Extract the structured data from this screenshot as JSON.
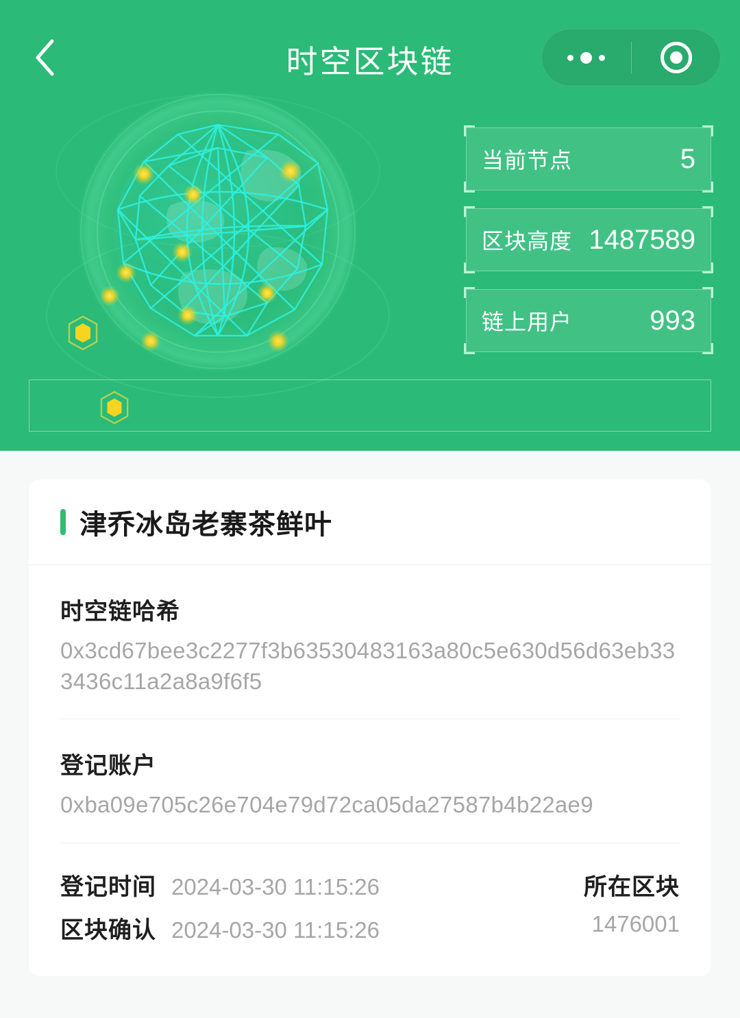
{
  "nav": {
    "back_icon": "chevron-left-icon",
    "title": "时空区块链",
    "capsule": {
      "more_icon": "more-dots-icon",
      "target_icon": "target-circle-icon"
    }
  },
  "hero": {
    "globe_icon": "network-globe-icon",
    "hex_icon": "hexagon-node-icon",
    "stats": [
      {
        "label": "当前节点",
        "value": "5"
      },
      {
        "label": "区块高度",
        "value": "1487589"
      },
      {
        "label": "链上用户",
        "value": "993"
      }
    ]
  },
  "card": {
    "title": "津乔冰岛老寨茶鲜叶",
    "fields": [
      {
        "label": "时空链哈希",
        "value": "0x3cd67bee3c2277f3b63530483163a80c5e630d56d63eb333436c11a2a8a9f6f5"
      },
      {
        "label": "登记账户",
        "value": "0xba09e705c26e704e79d72ca05da27587b4b22ae9"
      }
    ],
    "meta": {
      "register_time_label": "登记时间",
      "register_time_value": "2024-03-30 11:15:26",
      "block_confirm_label": "区块确认",
      "block_confirm_value": "2024-03-30 11:15:26",
      "block_label": "所在区块",
      "block_value": "1476001"
    }
  },
  "colors": {
    "brand_green": "#2bba77",
    "capsule_green": "#28ab6d",
    "accent_bar": "#33bb6e",
    "node_yellow": "#f5d422",
    "mesh_cyan": "#2ef0e0",
    "page_bg": "#f7f8f8"
  }
}
